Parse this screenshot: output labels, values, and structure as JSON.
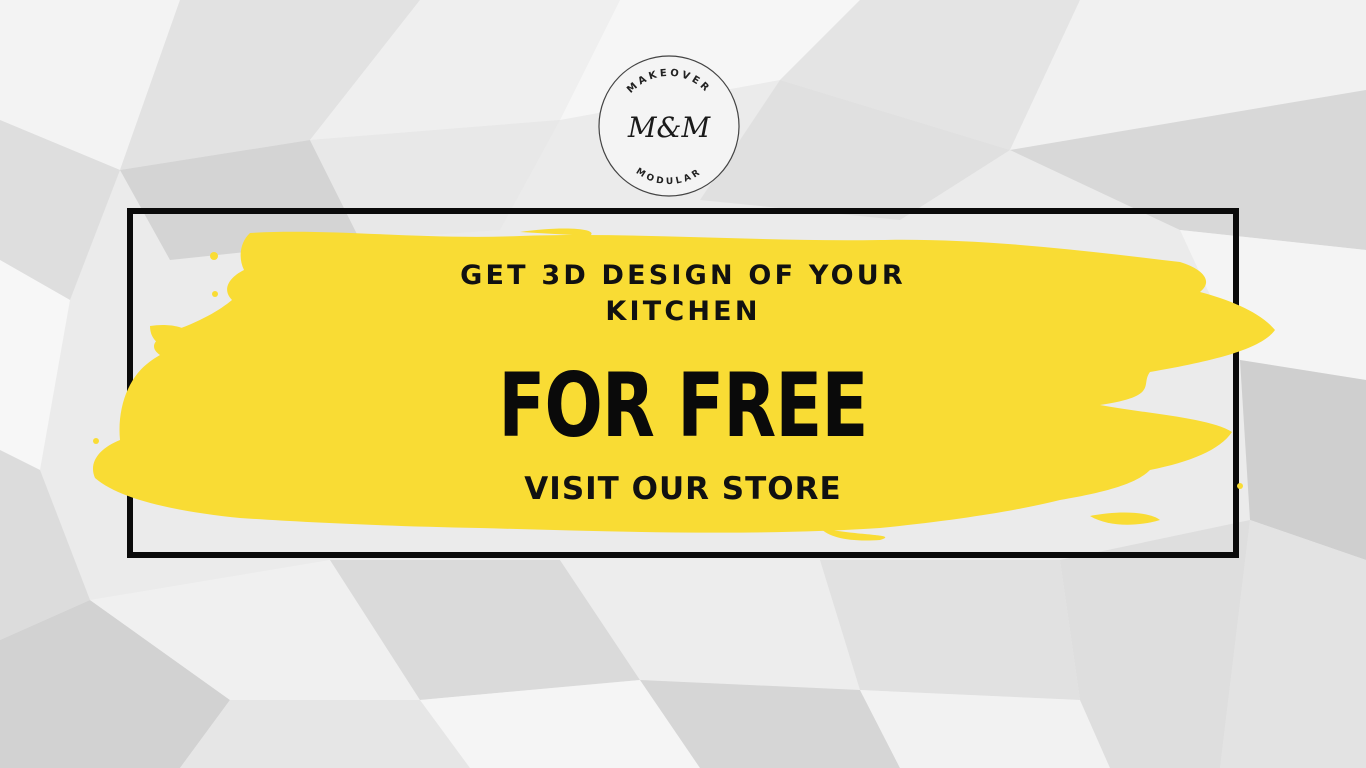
{
  "colors": {
    "background": "#ececec",
    "brush": "#f9dc34",
    "frame": "#0a0a0a",
    "text": "#111111"
  },
  "logo": {
    "arc_top": "MAKEOVER",
    "monogram": "M&M",
    "arc_bottom": "MODULAR"
  },
  "promo": {
    "headline_line1": "GET 3D DESIGN OF YOUR",
    "headline_line2": "KITCHEN",
    "main": "FOR FREE",
    "cta": "VISIT OUR STORE"
  }
}
